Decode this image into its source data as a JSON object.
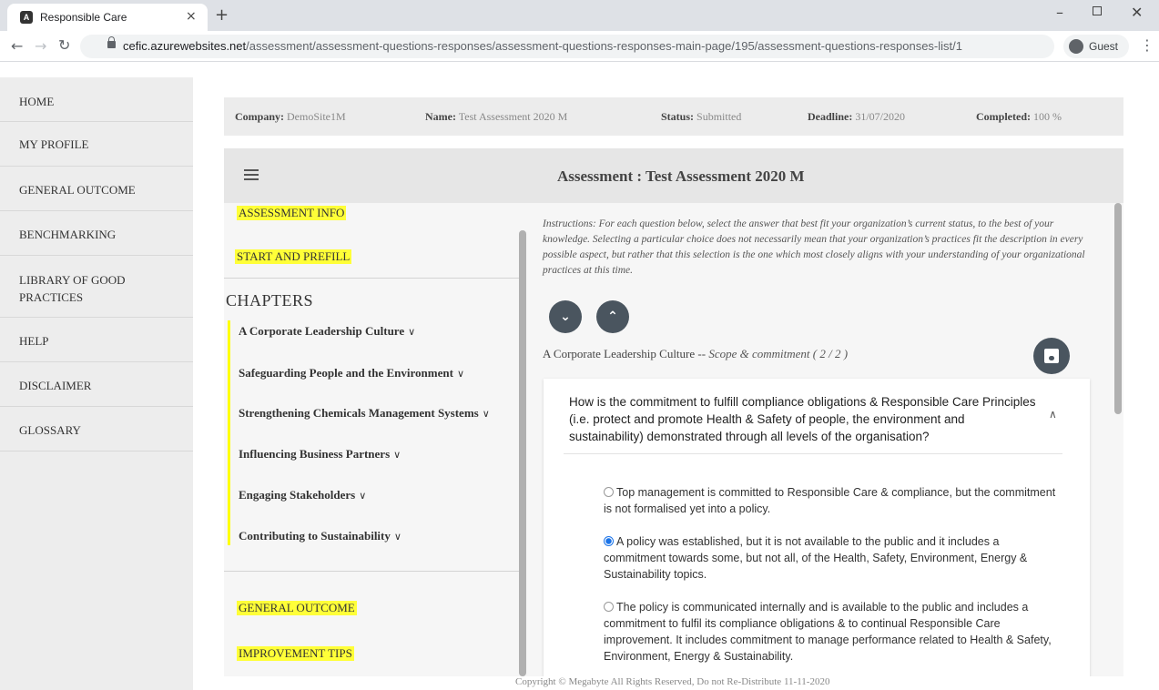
{
  "browser": {
    "tab_title": "Responsible Care",
    "favicon": "A",
    "tab_close": "×",
    "new_tab": "+",
    "url_host": "cefic.azurewebsites.net",
    "url_path": "/assessment/assessment-questions-responses/assessment-questions-responses-main-page/195/assessment-questions-responses-list/1",
    "profile_label": "Guest"
  },
  "sidebar": {
    "items": [
      {
        "label": "HOME"
      },
      {
        "label": "MY PROFILE"
      },
      {
        "label": "GENERAL OUTCOME"
      },
      {
        "label": "BENCHMARKING"
      },
      {
        "label": "LIBRARY OF GOOD PRACTICES"
      },
      {
        "label": "HELP"
      },
      {
        "label": "DISCLAIMER"
      },
      {
        "label": "GLOSSARY"
      }
    ]
  },
  "info": {
    "company_label": "Company:",
    "company_value": "DemoSite1M",
    "name_label": "Name:",
    "name_value": "Test Assessment 2020 M",
    "status_label": "Status:",
    "status_value": "Submitted",
    "deadline_label": "Deadline:",
    "deadline_value": "31/07/2020",
    "completed_label": "Completed:",
    "completed_value": "100 %"
  },
  "header": {
    "title": "Assessment : Test Assessment 2020 M"
  },
  "left_panel": {
    "assessment_info": "ASSESSMENT INFO",
    "start_prefill": "START AND PREFILL",
    "chapters_title": "CHAPTERS",
    "chapters": [
      {
        "label": "A Corporate Leadership Culture"
      },
      {
        "label": "Safeguarding People and the Environment"
      },
      {
        "label": "Strengthening Chemicals Management Systems"
      },
      {
        "label": "Influencing Business Partners"
      },
      {
        "label": "Engaging Stakeholders"
      },
      {
        "label": "Contributing to Sustainability"
      }
    ],
    "general_outcome": "GENERAL OUTCOME",
    "improvement_tips": "IMPROVEMENT TIPS"
  },
  "question_panel": {
    "instructions": "Instructions: For each question below, select the answer that best fit your organization’s current status, to the best of your knowledge. Selecting a particular choice does not necessarily mean that your organization’s practices fit the description in every possible aspect, but rather that this selection is the one which most closely aligns with your understanding of your organizational practices at this time.",
    "breadcrumb_chapter": "A Corporate Leadership Culture --",
    "breadcrumb_section": "Scope & commitment ( 2 / 2 )",
    "question": "How is the commitment to fulfill compliance obligations & Responsible Care Principles (i.e. protect and promote Health & Safety of people, the environment and sustainability) demonstrated through all levels of the organisation?",
    "options": [
      {
        "text": "Top management is committed to Responsible Care & compliance, but the commitment is not formalised yet into a policy.",
        "selected": false
      },
      {
        "text": "A policy was established, but it is not available to the public and it includes a commitment towards some, but not all, of the Health, Safety, Environment, Energy & Sustainability topics.",
        "selected": true
      },
      {
        "text": "The policy is communicated internally and is available to the public and includes a commitment to fulfil its compliance obligations & to continual Responsible Care improvement. It includes commitment to manage performance related to Health & Safety, Environment, Energy & Sustainability.",
        "selected": false
      }
    ]
  },
  "footer": {
    "copyright": "Copyright © Megabyte All Rights Reserved, Do not Re-Distribute 11-11-2020"
  },
  "colors": {
    "highlight": "#ffff38",
    "round_button": "#4a555f",
    "selected_radio": "#1a73e8"
  }
}
